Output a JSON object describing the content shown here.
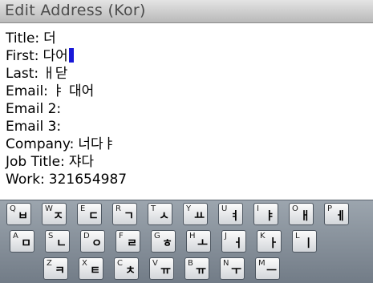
{
  "window": {
    "title": "Edit Address (Kor)"
  },
  "fields": [
    {
      "label": "Title:",
      "value": "더"
    },
    {
      "label": "First:",
      "value": "다어",
      "cursor": true
    },
    {
      "label": "Last:",
      "value": "ㅐ닫"
    },
    {
      "label": "Email:",
      "value": "ㅑ 대어"
    },
    {
      "label": "Email 2:",
      "value": ""
    },
    {
      "label": "Email 3:",
      "value": ""
    },
    {
      "label": "Company:",
      "value": "너다ㅑ"
    },
    {
      "label": "Job Title:",
      "value": "쟈다"
    },
    {
      "label": "Work:",
      "value": "321654987"
    }
  ],
  "keyboard": {
    "rows": [
      [
        {
          "lat": "Q",
          "kor": "ㅂ"
        },
        {
          "lat": "W",
          "kor": "ㅈ"
        },
        {
          "lat": "E",
          "kor": "ㄷ"
        },
        {
          "lat": "R",
          "kor": "ㄱ"
        },
        {
          "lat": "T",
          "kor": "ㅅ"
        },
        {
          "lat": "Y",
          "kor": "ㅛ"
        },
        {
          "lat": "U",
          "kor": "ㅕ"
        },
        {
          "lat": "I",
          "kor": "ㅑ"
        },
        {
          "lat": "O",
          "kor": "ㅐ"
        },
        {
          "lat": "P",
          "kor": "ㅔ"
        }
      ],
      [
        {
          "lat": "A",
          "kor": "ㅁ"
        },
        {
          "lat": "S",
          "kor": "ㄴ"
        },
        {
          "lat": "D",
          "kor": "ㅇ"
        },
        {
          "lat": "F",
          "kor": "ㄹ"
        },
        {
          "lat": "G",
          "kor": "ㅎ"
        },
        {
          "lat": "H",
          "kor": "ㅗ"
        },
        {
          "lat": "J",
          "kor": "ㅓ"
        },
        {
          "lat": "K",
          "kor": "ㅏ"
        },
        {
          "lat": "L",
          "kor": "ㅣ"
        }
      ],
      [
        {
          "lat": "Z",
          "kor": "ㅋ"
        },
        {
          "lat": "X",
          "kor": "ㅌ"
        },
        {
          "lat": "C",
          "kor": "ㅊ"
        },
        {
          "lat": "V",
          "kor": "ㅠ"
        },
        {
          "lat": "B",
          "kor": "ㅠ"
        },
        {
          "lat": "N",
          "kor": "ㅜ"
        },
        {
          "lat": "M",
          "kor": "ㅡ"
        }
      ]
    ]
  }
}
